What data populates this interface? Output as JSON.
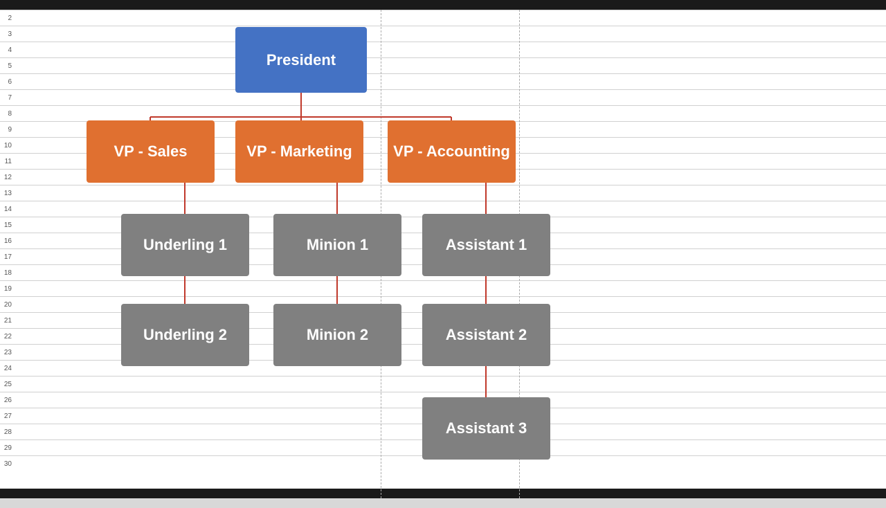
{
  "topBar": {
    "color": "#1a1a1a"
  },
  "bottomBar": {
    "color": "#1a1a1a"
  },
  "rowNumbers": [
    "2",
    "3",
    "4",
    "5",
    "6",
    "7",
    "8",
    "9",
    "10",
    "11",
    "12",
    "13",
    "14",
    "15",
    "16",
    "17",
    "18",
    "19",
    "20",
    "21",
    "22",
    "23",
    "24",
    "25",
    "26",
    "27",
    "28",
    "29",
    "30"
  ],
  "boxes": {
    "president": {
      "label": "President"
    },
    "vpSales": {
      "label": "VP - Sales"
    },
    "vpMarketing": {
      "label": "VP - Marketing"
    },
    "vpAccounting": {
      "label": "VP - Accounting"
    },
    "underling1": {
      "label": "Underling 1"
    },
    "underling2": {
      "label": "Underling 2"
    },
    "minion1": {
      "label": "Minion 1"
    },
    "minion2": {
      "label": "Minion 2"
    },
    "assistant1": {
      "label": "Assistant 1"
    },
    "assistant2": {
      "label": "Assistant 2"
    },
    "assistant3": {
      "label": "Assistant 3"
    }
  },
  "connectorColor": "#c0392b",
  "verticalDashedLines": [
    530,
    730
  ]
}
